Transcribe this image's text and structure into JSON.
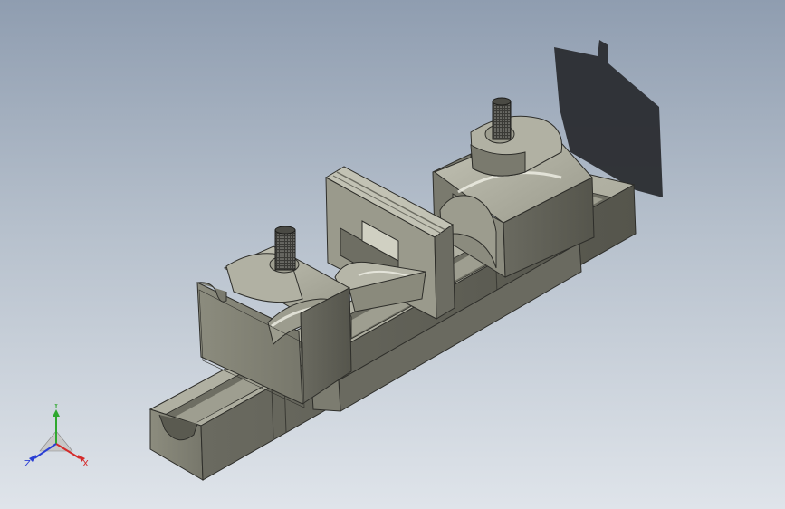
{
  "triad": {
    "x_label": "X",
    "y_label": "Y",
    "z_label": "Z",
    "x_color": "#d42a2a",
    "y_color": "#2fa82f",
    "z_color": "#2a3fd4"
  },
  "colors": {
    "background_top": "#8f9db0",
    "background_bottom": "#dfe4ea",
    "part_face": "#8a8a7c",
    "part_light": "#b7b7a8",
    "part_dark": "#5f5f55",
    "shadow": "#2a2c30"
  }
}
